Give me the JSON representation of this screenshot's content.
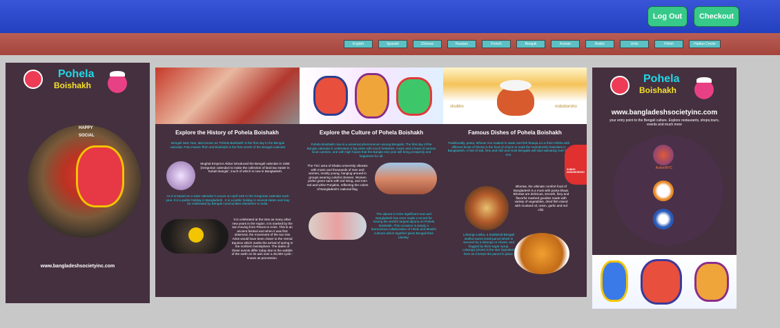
{
  "topbar": {
    "logout_label": "Log Out",
    "checkout_label": "Checkout"
  },
  "languages": [
    "English",
    "Spanish",
    "Chinese",
    "Russian",
    "French",
    "Bengali",
    "Korean",
    "Arabic",
    "Urdu",
    "Polish",
    "Haitian Creole"
  ],
  "left_panel": {
    "logo_line1": "Pohela",
    "logo_line2": "Boishakh",
    "vertical_text": "HAPPY SOCIAL",
    "url": "www.bangladeshsocietyinc.com"
  },
  "history": {
    "title": "Explore the History of Pohela Boishakh",
    "p1": "Bengali New Year, also known as 'Pohela Boishakh' is the first day in the Bengali calendar. Pola means 'first' and Boishakh is the first month of the Bengali calendar",
    "p2": "Mughal Emperor Akbar introduced the Bengali calendar in 1556 (Gregorian calendar) to make the collection of land tax easier in 'Subah Bangla', much of which is now in Bangladesh.",
    "p3": "As it is based on a solar calendar it occurs on April 14th in the Gregorian calendar each year. It is a public holiday in Bangladesh , It is a public holiday in several states and may be celebrated by Bengali communities elsewhere in India.",
    "p4": "It is celebrated at the time as many other new years in the region. It is marked by the sun moving from Pisces to Aries. This is an ancient festival and when it was first observed, the movement of the sun into Aries would have been closer to the Vernal Equinox which marks the arrival of spring in the northern hemisphere. The dates of these events differ today due to the wobble of the earth on its axis over a 25,000 cycle - known as procession."
  },
  "culture": {
    "title": "Explore the Culture of Pohela Boishakh",
    "p1": "Pohela Boishakh now is a universal phenomenon among Bengalis. The first day of the Bangla calendar is celebrated in big cities with much festivities, music and a feast of various local cuisines, and with high hopes that the Bangla new year will bring prosperity and happiness for all.",
    "p2": "The TSC area of Dhaka University vibrates with music and thousands of men and women, mostly young, hanging around in groups wearing colorful dresses. Women prefer green saris with red lining, and men red and white Punjabis, reflecting the colors of Bangladesh's national flag.",
    "p3": "The alpona is more significant now and Bangladesh has even made a record for having the world's largest alpona on Pohela Boishakh. This occasion is simply a harmonious collaboration of Hindu and Muslim cultures which together gives Bengali their identity."
  },
  "dishes": {
    "title": "Famous Dishes of Pohela Boishakh",
    "p1": "Traditionally, panta, leftover rice soaked in water and fish bhaaja a.k.a fries! Hilsha with different kinds of bhorta is the food of choice to mark the Noboborsho festivities in Bangladesh. A hint of salt, lime and chili and most Bengalis will start salivating over this rice.",
    "p2": "Bhortas, the ultimate comfort food of Bangladesh is a must with panta bhaat. Bhortas are delicious, smooth, fiery and flavorful mashed goodies made with variety of vegetables, dried fish mixed with mustard oil, onion, garlic and red chili.",
    "p3": "Lobongo Latika, a traditional Bengali stuffed sweet small parcel which is secured by a lobongo or cloves, and fragged by thick sugar syrup. Lobongo (clove) is the star ingredient here as it keeps the parcel in place.",
    "banner_left": "shubho",
    "banner_right": "noboborsho",
    "side_label": "SUBHO NOBOBORSHO"
  },
  "right_panel": {
    "logo_line1": "Pohela",
    "logo_line2": "Boishakh",
    "url": "www.bangladeshsocietyinc.com",
    "tagline": "your entry point to the Bengali culture. Explore restaurants, shops,tours, events and much more",
    "icon_label": "ActionNYC"
  },
  "colors": {
    "topbar": "#2240bf",
    "langbar": "#a5453d",
    "panel": "#45303f",
    "accent_text": "#21d9e8",
    "button_green": "#36c98a"
  }
}
